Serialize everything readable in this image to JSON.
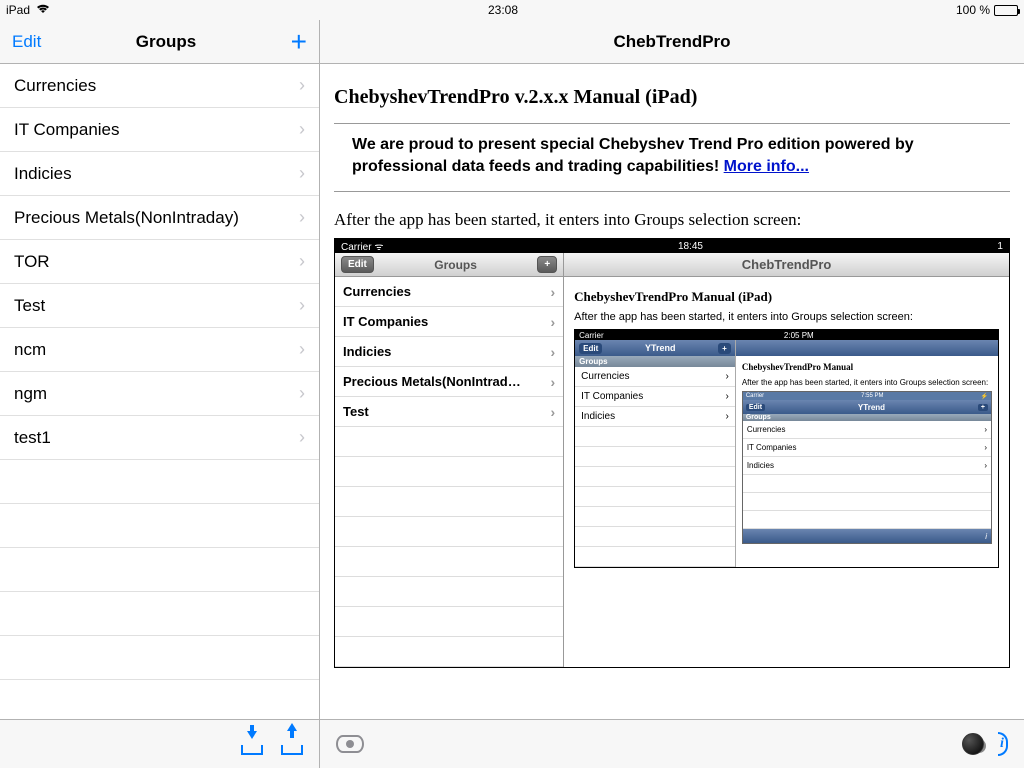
{
  "status": {
    "device": "iPad",
    "time": "23:08",
    "battery_text": "100 %"
  },
  "leftNav": {
    "edit": "Edit",
    "title": "Groups",
    "add": "+"
  },
  "groups": [
    "Currencies",
    "IT Companies",
    "Indicies",
    "Precious Metals(NonIntraday)",
    "TOR",
    "Test",
    "ncm",
    "ngm",
    "test1"
  ],
  "rightNav": {
    "title": "ChebTrendPro"
  },
  "manual": {
    "heading": "ChebyshevTrendPro v.2.x.x Manual (iPad)",
    "promo_text": "We are proud to present special Chebyshev Trend Pro edition powered by professional data feeds and trading capabilities! ",
    "promo_link": "More info...",
    "intro": "After the app has been started, it enters into Groups selection screen:"
  },
  "mock1": {
    "status": {
      "carrier": "Carrier",
      "time": "18:45"
    },
    "nav": {
      "edit": "Edit",
      "title": "Groups",
      "plus": "+",
      "right_title": "ChebTrendPro"
    },
    "rows": [
      "Currencies",
      "IT Companies",
      "Indicies",
      "Precious Metals(NonIntrad…",
      "Test"
    ],
    "right": {
      "heading": "ChebyshevTrendPro Manual (iPad)",
      "intro": "After the app has been started, it enters into Groups selection screen:"
    }
  },
  "mock2": {
    "status": {
      "carrier": "Carrier",
      "time": "2:05 PM"
    },
    "nav": {
      "edit": "Edit",
      "title": "YTrend",
      "plus": "+"
    },
    "section": "Groups",
    "rows": [
      "Currencies",
      "IT Companies",
      "Indicies"
    ],
    "right": {
      "heading": "ChebyshevTrendPro Manual",
      "intro": "After the app has been started, it enters into Groups selection screen:"
    }
  },
  "mock3": {
    "status": {
      "carrier": "Carrier",
      "time": "7:55 PM"
    },
    "nav": {
      "edit": "Edit",
      "title": "YTrend",
      "plus": "+"
    },
    "section": "Groups",
    "rows": [
      "Currencies",
      "IT Companies",
      "Indicies"
    ],
    "footer": "i"
  }
}
